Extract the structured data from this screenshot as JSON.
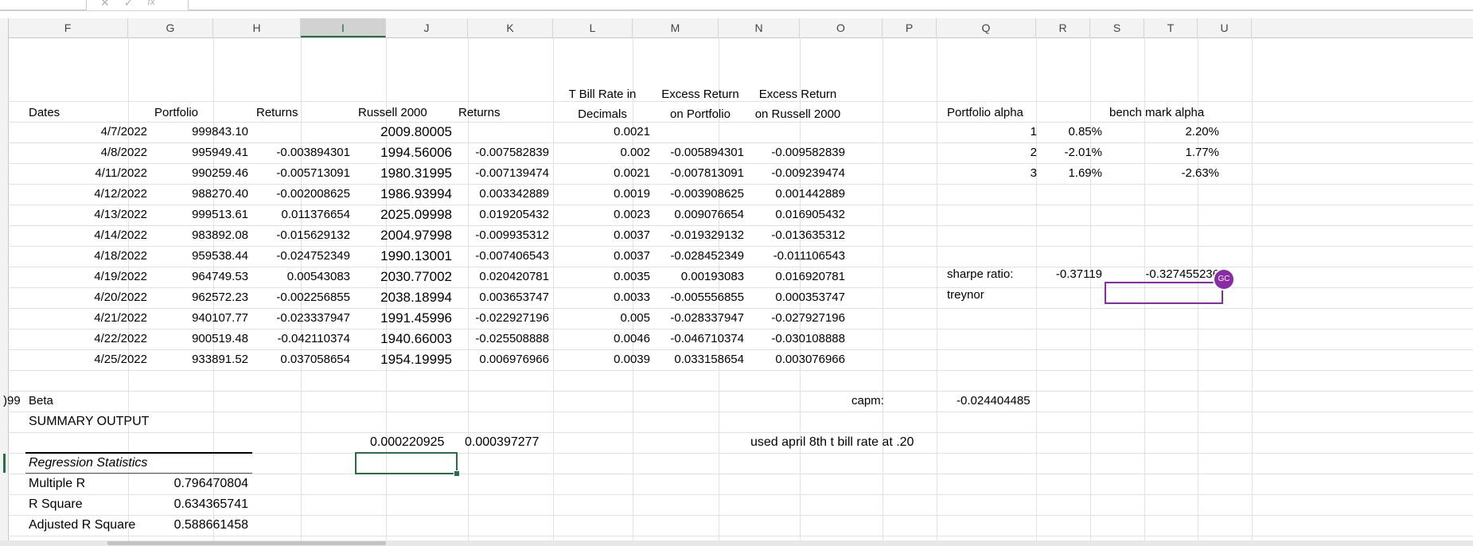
{
  "formula_bar": {
    "icons": [
      "cancel-icon",
      "enter-icon",
      "function-icon"
    ],
    "cancel_glyph": "✕",
    "enter_glyph": "✓",
    "fx_glyph": "fx"
  },
  "columns": [
    "F",
    "G",
    "H",
    "I",
    "J",
    "K",
    "L",
    "M",
    "N",
    "O",
    "P",
    "Q",
    "R",
    "S",
    "T",
    "U"
  ],
  "selected_column": "I",
  "headers": {
    "dates": "Dates",
    "portfolio": "Portfolio",
    "returns1": "Returns",
    "russell": "Russell 2000",
    "returns2": "Returns",
    "tbill_line1": "T Bill Rate in",
    "tbill_line2": "Decimals",
    "excess_port_line1": "Excess Return",
    "excess_port_line2": "on Portfolio",
    "excess_russ_line1": "Excess Return",
    "excess_russ_line2": "on Russell 2000",
    "portfolio_alpha": "Portfolio alpha",
    "benchmark_alpha": "bench mark alpha"
  },
  "rows": [
    {
      "date": "4/7/2022",
      "portfolio": "999843.10",
      "ret": "",
      "russell": "2009.80005",
      "rret": "",
      "tbill": "0.0021",
      "exp": "",
      "exr": ""
    },
    {
      "date": "4/8/2022",
      "portfolio": "995949.41",
      "ret": "-0.003894301",
      "russell": "1994.56006",
      "rret": "-0.007582839",
      "tbill": "0.002",
      "exp": "-0.005894301",
      "exr": "-0.009582839"
    },
    {
      "date": "4/11/2022",
      "portfolio": "990259.46",
      "ret": "-0.005713091",
      "russell": "1980.31995",
      "rret": "-0.007139474",
      "tbill": "0.0021",
      "exp": "-0.007813091",
      "exr": "-0.009239474"
    },
    {
      "date": "4/12/2022",
      "portfolio": "988270.40",
      "ret": "-0.002008625",
      "russell": "1986.93994",
      "rret": "0.003342889",
      "tbill": "0.0019",
      "exp": "-0.003908625",
      "exr": "0.001442889"
    },
    {
      "date": "4/13/2022",
      "portfolio": "999513.61",
      "ret": "0.011376654",
      "russell": "2025.09998",
      "rret": "0.019205432",
      "tbill": "0.0023",
      "exp": "0.009076654",
      "exr": "0.016905432"
    },
    {
      "date": "4/14/2022",
      "portfolio": "983892.08",
      "ret": "-0.015629132",
      "russell": "2004.97998",
      "rret": "-0.009935312",
      "tbill": "0.0037",
      "exp": "-0.019329132",
      "exr": "-0.013635312"
    },
    {
      "date": "4/18/2022",
      "portfolio": "959538.44",
      "ret": "-0.024752349",
      "russell": "1990.13001",
      "rret": "-0.007406543",
      "tbill": "0.0037",
      "exp": "-0.028452349",
      "exr": "-0.011106543"
    },
    {
      "date": "4/19/2022",
      "portfolio": "964749.53",
      "ret": "0.00543083",
      "russell": "2030.77002",
      "rret": "0.020420781",
      "tbill": "0.0035",
      "exp": "0.00193083",
      "exr": "0.016920781"
    },
    {
      "date": "4/20/2022",
      "portfolio": "962572.23",
      "ret": "-0.002256855",
      "russell": "2038.18994",
      "rret": "0.003653747",
      "tbill": "0.0033",
      "exp": "-0.005556855",
      "exr": "0.000353747"
    },
    {
      "date": "4/21/2022",
      "portfolio": "940107.77",
      "ret": "-0.023337947",
      "russell": "1991.45996",
      "rret": "-0.022927196",
      "tbill": "0.005",
      "exp": "-0.028337947",
      "exr": "-0.027927196"
    },
    {
      "date": "4/22/2022",
      "portfolio": "900519.48",
      "ret": "-0.042110374",
      "russell": "1940.66003",
      "rret": "-0.025508888",
      "tbill": "0.0046",
      "exp": "-0.046710374",
      "exr": "-0.030108888"
    },
    {
      "date": "4/25/2022",
      "portfolio": "933891.52",
      "ret": "0.037058654",
      "russell": "1954.19995",
      "rret": "0.006976966",
      "tbill": "0.0039",
      "exp": "0.033158654",
      "exr": "0.003076966"
    }
  ],
  "alpha_table": [
    {
      "n": "1",
      "p": "0.85%",
      "q": "2.20%"
    },
    {
      "n": "2",
      "p": "-2.01%",
      "q": "1.77%"
    },
    {
      "n": "3",
      "p": "1.69%",
      "q": "-2.63%"
    }
  ],
  "sharpe": {
    "label": "sharpe ratio:",
    "p": "-0.37119",
    "q": "-0.327455236"
  },
  "treynor": {
    "label": "treynor"
  },
  "collab": {
    "initials": "GC",
    "color": "#8b2aa8"
  },
  "beta_row": {
    "cut": ")99",
    "label": "Beta",
    "capm_label": "capm:",
    "capm_value": "-0.024404485"
  },
  "summary_output": "SUMMARY OUTPUT",
  "extra_row": {
    "i": "0.000220925",
    "j": "0.000397277",
    "note": "used april 8th t bill rate at .20"
  },
  "regression": {
    "title": "Regression Statistics",
    "items": [
      {
        "label": "Multiple R",
        "value": "0.796470804"
      },
      {
        "label": "R Square",
        "value": "0.634365741"
      },
      {
        "label": "Adjusted R Square",
        "value": "0.588661458"
      }
    ]
  },
  "selection_color": "#217346"
}
